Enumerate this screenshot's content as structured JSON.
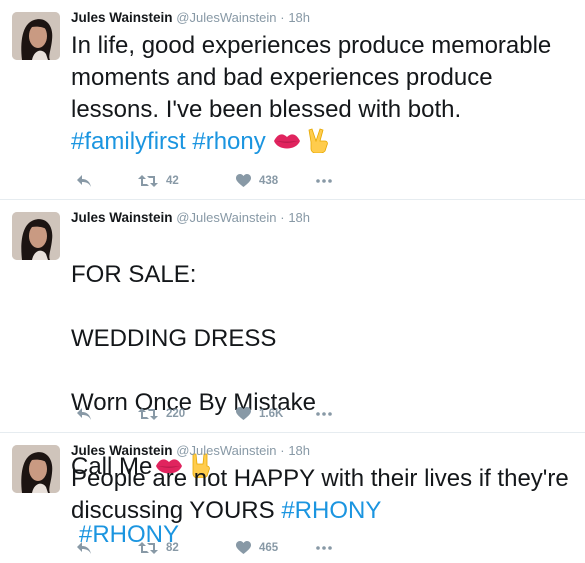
{
  "tweets": [
    {
      "author": "Jules Wainstein",
      "handle": "@JulesWainstein",
      "separator": "·",
      "time": "18h",
      "text": "In life, good experiences produce memorable moments and bad experiences produce lessons. I've been blessed with both.",
      "hashtags": [
        "#familyfirst",
        "#rhony"
      ],
      "emojis": [
        "kiss-lips-icon",
        "victory-hand-icon"
      ],
      "retweets": "42",
      "likes": "438"
    },
    {
      "author": "Jules Wainstein",
      "handle": "@JulesWainstein",
      "separator": "·",
      "time": "18h",
      "lines": [
        "FOR SALE:",
        "WEDDING DRESS",
        "Worn Once By Mistake",
        "Call Me"
      ],
      "hashtag": "#RHONY",
      "emojis": [
        "kiss-lips-icon",
        "rock-on-hand-icon"
      ],
      "retweets": "220",
      "likes": "1.6K"
    },
    {
      "author": "Jules Wainstein",
      "handle": "@JulesWainstein",
      "separator": "·",
      "time": "18h",
      "text": "People are not HAPPY with their lives if they're discussing YOURS",
      "hashtag": "#RHONY",
      "retweets": "82",
      "likes": "465"
    }
  ],
  "colors": {
    "link": "#1b95e0",
    "muted": "#8899a6",
    "text": "#14171a",
    "divider": "#e6ecf0",
    "lips": "#e0245e"
  }
}
